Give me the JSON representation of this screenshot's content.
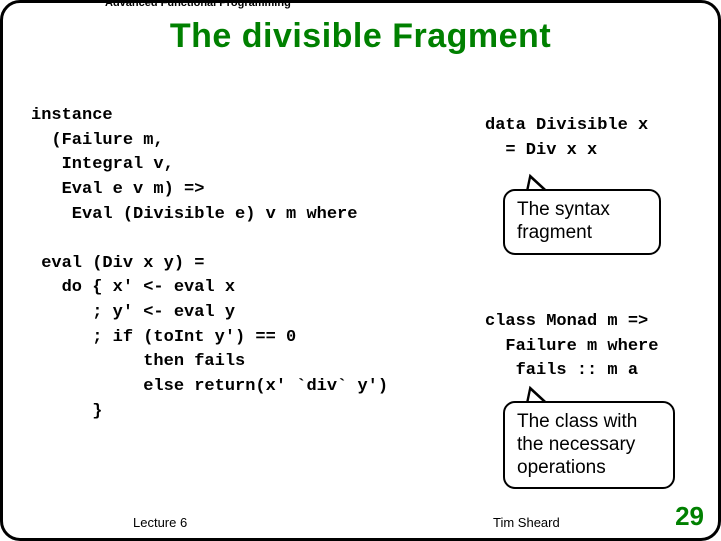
{
  "header": {
    "label": "Advanced Functional Programming"
  },
  "title": "The divisible Fragment",
  "code": {
    "left": "instance\n  (Failure m,\n   Integral v,\n   Eval e v m) =>\n    Eval (Divisible e) v m where\n\n eval (Div x y) =\n   do { x' <- eval x\n      ; y' <- eval y\n      ; if (toInt y') == 0\n           then fails\n           else return(x' `div` y')\n      }",
    "right1": "data Divisible x\n  = Div x x",
    "right2": "class Monad m =>\n  Failure m where\n   fails :: m a"
  },
  "callouts": {
    "c1": "The syntax fragment",
    "c2": "The class with the necessary operations"
  },
  "footer": {
    "lecture": "Lecture 6",
    "author": "Tim Sheard",
    "page": "29"
  }
}
